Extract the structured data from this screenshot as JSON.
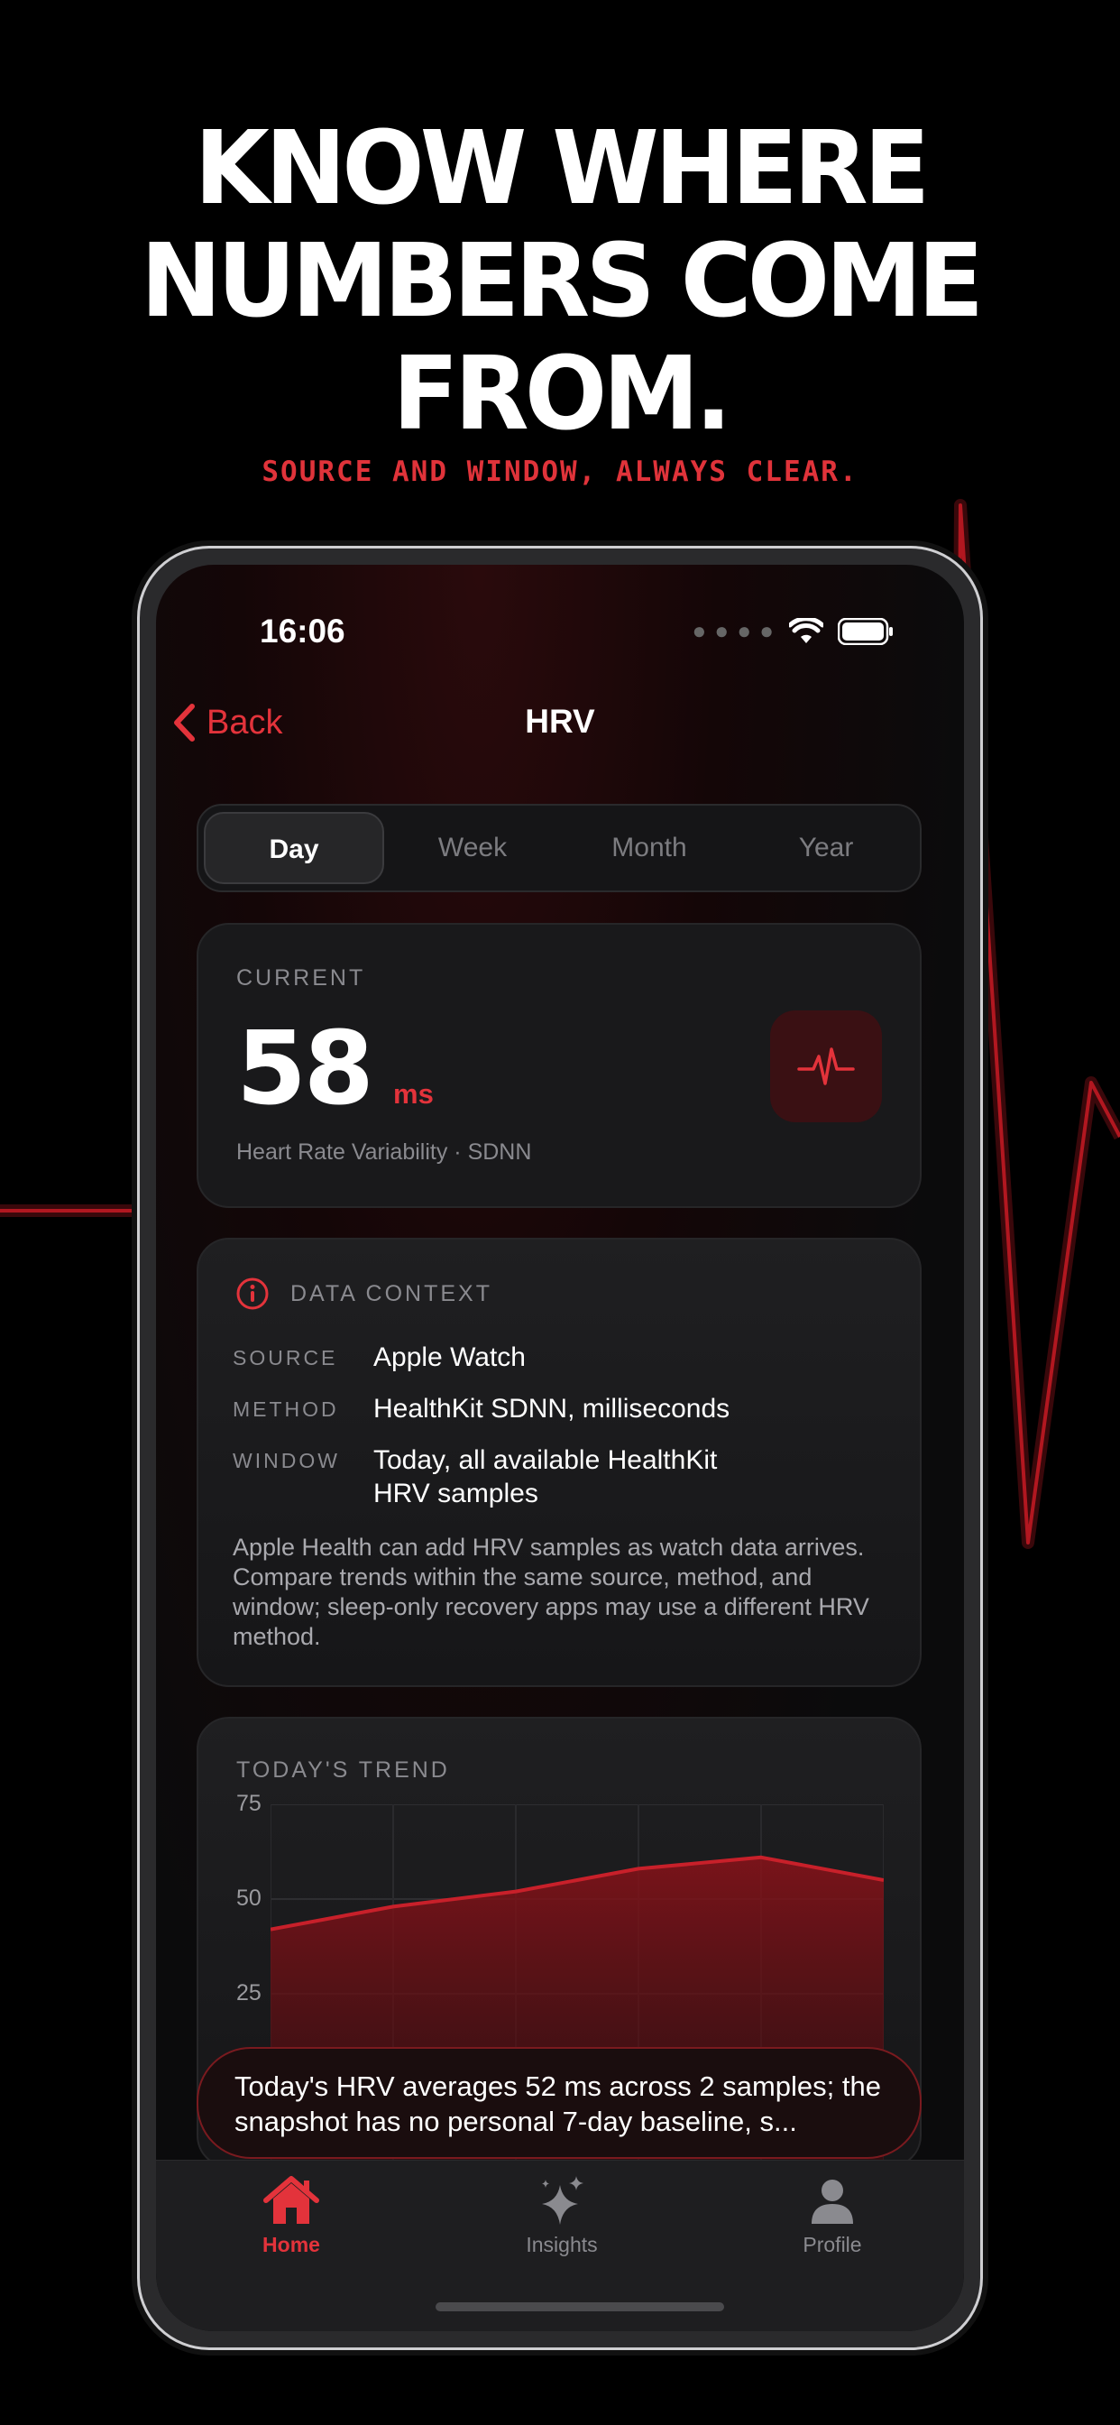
{
  "promo": {
    "headline_lines": [
      "KNOW WHERE",
      "NUMBERS COME",
      "FROM."
    ],
    "subheadline": "SOURCE AND WINDOW, ALWAYS CLEAR."
  },
  "status_bar": {
    "time": "16:06"
  },
  "nav": {
    "back_label": "Back",
    "title": "HRV"
  },
  "segments": [
    {
      "label": "Day",
      "active": true
    },
    {
      "label": "Week",
      "active": false
    },
    {
      "label": "Month",
      "active": false
    },
    {
      "label": "Year",
      "active": false
    }
  ],
  "current_card": {
    "label": "CURRENT",
    "value": "58",
    "unit": "ms",
    "subtitle": "Heart Rate Variability · SDNN",
    "icon": "pulse-icon"
  },
  "context_card": {
    "title": "DATA CONTEXT",
    "icon": "info-icon",
    "rows": [
      {
        "key": "SOURCE",
        "value": "Apple Watch"
      },
      {
        "key": "METHOD",
        "value": "HealthKit SDNN, milliseconds"
      },
      {
        "key": "WINDOW",
        "value": "Today, all available HealthKit HRV samples"
      }
    ],
    "note": "Apple Health can add HRV samples as watch data arrives. Compare trends within the same source, method, and window; sleep-only recovery apps may use a different HRV method."
  },
  "trend_card": {
    "title": "TODAY'S TREND",
    "y_tick_labels": [
      "75",
      "50",
      "25"
    ]
  },
  "chart_data": {
    "type": "area",
    "title": "",
    "xlabel": "",
    "ylabel": "",
    "ylim": [
      0,
      75
    ],
    "y_ticks": [
      75,
      50,
      25
    ],
    "grid": true,
    "x": [
      0,
      1,
      2,
      3,
      4,
      5
    ],
    "series": [
      {
        "values": [
          42,
          48,
          52,
          58,
          61,
          55
        ]
      }
    ],
    "color": "#c8202a"
  },
  "summary_pill": {
    "text": "Today's HRV averages 52 ms across 2 samples; the snapshot has no personal 7-day baseline, s..."
  },
  "tabbar": {
    "items": [
      {
        "label": "Home",
        "icon": "house-icon",
        "active": true
      },
      {
        "label": "Insights",
        "icon": "sparkles-icon",
        "active": false
      },
      {
        "label": "Profile",
        "icon": "person-icon",
        "active": false
      }
    ]
  },
  "colors": {
    "accent": "#e3333b",
    "background": "#000000",
    "card": "#19191b"
  }
}
